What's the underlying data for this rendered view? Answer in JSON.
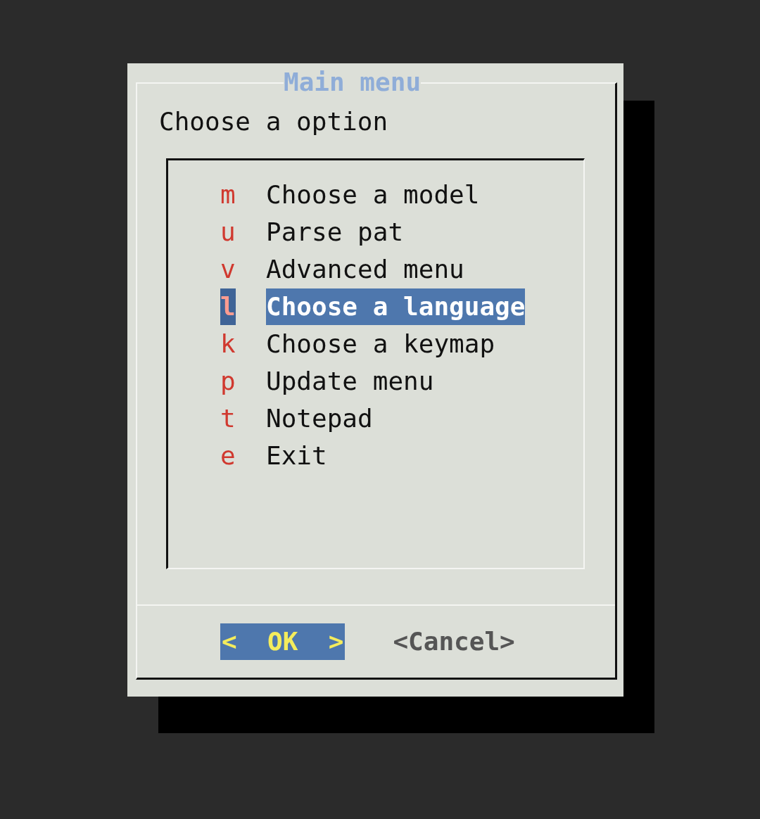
{
  "dialog": {
    "title": "Main menu",
    "prompt": "Choose a option"
  },
  "menu": {
    "items": [
      {
        "tag": "m",
        "label": "Choose a model",
        "selected": false
      },
      {
        "tag": "u",
        "label": "Parse pat",
        "selected": false
      },
      {
        "tag": "v",
        "label": "Advanced menu",
        "selected": false
      },
      {
        "tag": "l",
        "label": "Choose a language",
        "selected": true
      },
      {
        "tag": "k",
        "label": "Choose a keymap",
        "selected": false
      },
      {
        "tag": "p",
        "label": "Update menu",
        "selected": false
      },
      {
        "tag": "t",
        "label": "Notepad",
        "selected": false
      },
      {
        "tag": "e",
        "label": "Exit",
        "selected": false
      }
    ]
  },
  "buttons": [
    {
      "label": "<  OK  >",
      "selected": true
    },
    {
      "label": "<Cancel>",
      "selected": false
    }
  ]
}
